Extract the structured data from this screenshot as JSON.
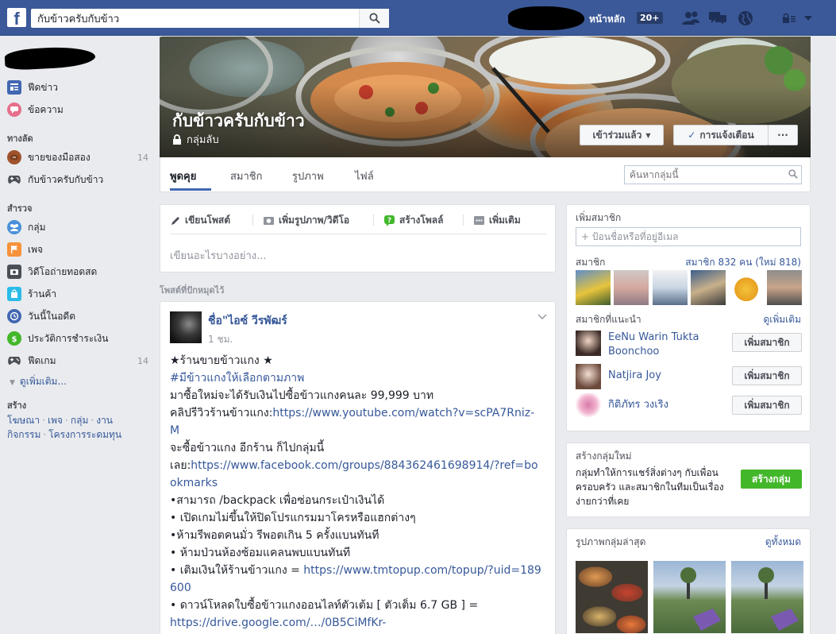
{
  "topbar": {
    "logo": "f",
    "search_value": "กับข้าวครับกับข้าว",
    "home_label": "หน้าหลัก",
    "home_count": "20+"
  },
  "leftnav": {
    "feed": "ฟีดข่าว",
    "messages": "ข้อความ",
    "shortcuts_header": "ทางลัด",
    "shortcuts": [
      {
        "label": "ขายของมือสอง",
        "count": "14"
      },
      {
        "label": "กับข้าวครับกับข้าว",
        "count": ""
      }
    ],
    "explore_header": "สำรวจ",
    "explore": [
      {
        "label": "กลุ่ม",
        "count": ""
      },
      {
        "label": "เพจ",
        "count": ""
      },
      {
        "label": "วิดีโอถ่ายทอดสด",
        "count": ""
      },
      {
        "label": "ร้านค้า",
        "count": ""
      },
      {
        "label": "วันนี้ในอดีต",
        "count": ""
      },
      {
        "label": "ประวัติการชำระเงิน",
        "count": ""
      },
      {
        "label": "ฟีดเกม",
        "count": "14"
      }
    ],
    "see_more": "ดูเพิ่มเติม...",
    "create_header": "สร้าง",
    "create_links": [
      "โฆษณา",
      "เพจ",
      "กลุ่ม",
      "งาน",
      "กิจกรรม",
      "โครงการระดมทุน"
    ]
  },
  "cover": {
    "group_name": "กับข้าวครับกับข้าว",
    "privacy": "กลุ่มลับ",
    "joined_button": "เข้าร่วมแล้ว",
    "notify_button": "การแจ้งเตือน",
    "more_button": "···"
  },
  "tabs": [
    "พูดคุย",
    "สมาชิก",
    "รูปภาพ",
    "ไฟล์"
  ],
  "group_search_placeholder": "ค้นหากลุ่มนี้",
  "composer": {
    "tabs": [
      "เขียนโพสต์",
      "เพิ่มรูปภาพ/วิดีโอ",
      "สร้างโพลล์",
      "เพิ่มเติม"
    ],
    "placeholder": "เขียนอะไรบางอย่าง..."
  },
  "pinned_header": "โพสต์ที่ปักหมุดไว้",
  "post": {
    "author": "ชื่อ\"ไอซ์ วีรพัฒร์",
    "time": "1 ชม.",
    "lines": [
      {
        "text": "★ร้านขายข้าวแกง ★",
        "link": ""
      },
      {
        "text": "",
        "link": "#มีข้าวแกงให้เลือกตามภาพ"
      },
      {
        "text": "มาซื้อใหม่จะได้รับเงินไปซื้อข้าวแกงคนละ 99,999 บาท",
        "link": ""
      },
      {
        "text": "คลิปรีวิวร้านข้าวแกง:",
        "link": "https://www.youtube.com/watch?v=scPA7Rniz-M"
      },
      {
        "text": "จะซื้อข้าวแกง อีกร้าน ก็ไปกลุ่มนี้",
        "link": ""
      },
      {
        "text": "เลย:",
        "link": "https://www.facebook.com/groups/884362461698914/?ref=bookmarks"
      },
      {
        "text": "•สามารถ /backpack เพื่อซ่อนกระเป๋าเงินได้",
        "link": ""
      },
      {
        "text": "• เปิดเกมไม่ขึ้นให้ปิดโปรแกรมมาโครหรือแฮกต่างๆ",
        "link": ""
      },
      {
        "text": "•ห้ามรีพอตคนมั่ว รีพอตเกิน 5 ครั้งแบนทันที",
        "link": ""
      },
      {
        "text": "• ห้ามป่วนห้องซ้อมแคลนพบแบนทันที",
        "link": ""
      },
      {
        "text": "• เติมเงินให้ร้านข้าวแกง = ",
        "link": "https://www.tmtopup.com/topup/?uid=189600"
      },
      {
        "text": "• ดาวน์โหลดใบซื้อข้าวแกงออนไลท์ตัวเต้ม [ ตัวเต็ม 6.7 GB ] =",
        "link": ""
      },
      {
        "text": "",
        "link": "https://drive.google.com/…/0B5CiMfKr-"
      }
    ]
  },
  "members_card": {
    "title": "เพิ่มสมาชิก",
    "input_placeholder": "+ ป้อนชื่อหรือที่อยู่อีเมล",
    "members_label": "สมาชิก",
    "members_count": "สมาชิก 832 คน (ใหม่ 818)",
    "suggested_label": "สมาชิกที่แนะนำ",
    "see_more": "ดูเพิ่มเติม",
    "suggested": [
      {
        "name": "EeNu Warin Tukta Boonchoo",
        "button": "เพิ่มสมาชิก"
      },
      {
        "name": "Natjira Joy",
        "button": "เพิ่มสมาชิก"
      },
      {
        "name": "กิติภัทร วงเริง",
        "button": "เพิ่มสมาชิก"
      }
    ]
  },
  "create_group_card": {
    "title": "สร้างกลุ่มใหม่",
    "text": "กลุ่มทำให้การแชร์สิ่งต่างๆ กับเพื่อน ครอบครัว และสมาชิกในทีมเป็นเรื่องง่ายกว่าที่เคย",
    "button": "สร้างกลุ่ม"
  },
  "photos_card": {
    "title": "รูปภาพกลุ่มล่าสุด",
    "see_all": "ดูทั้งหมด"
  },
  "colors": {
    "brand": "#3b5998",
    "link": "#365899",
    "green": "#42b72a"
  }
}
